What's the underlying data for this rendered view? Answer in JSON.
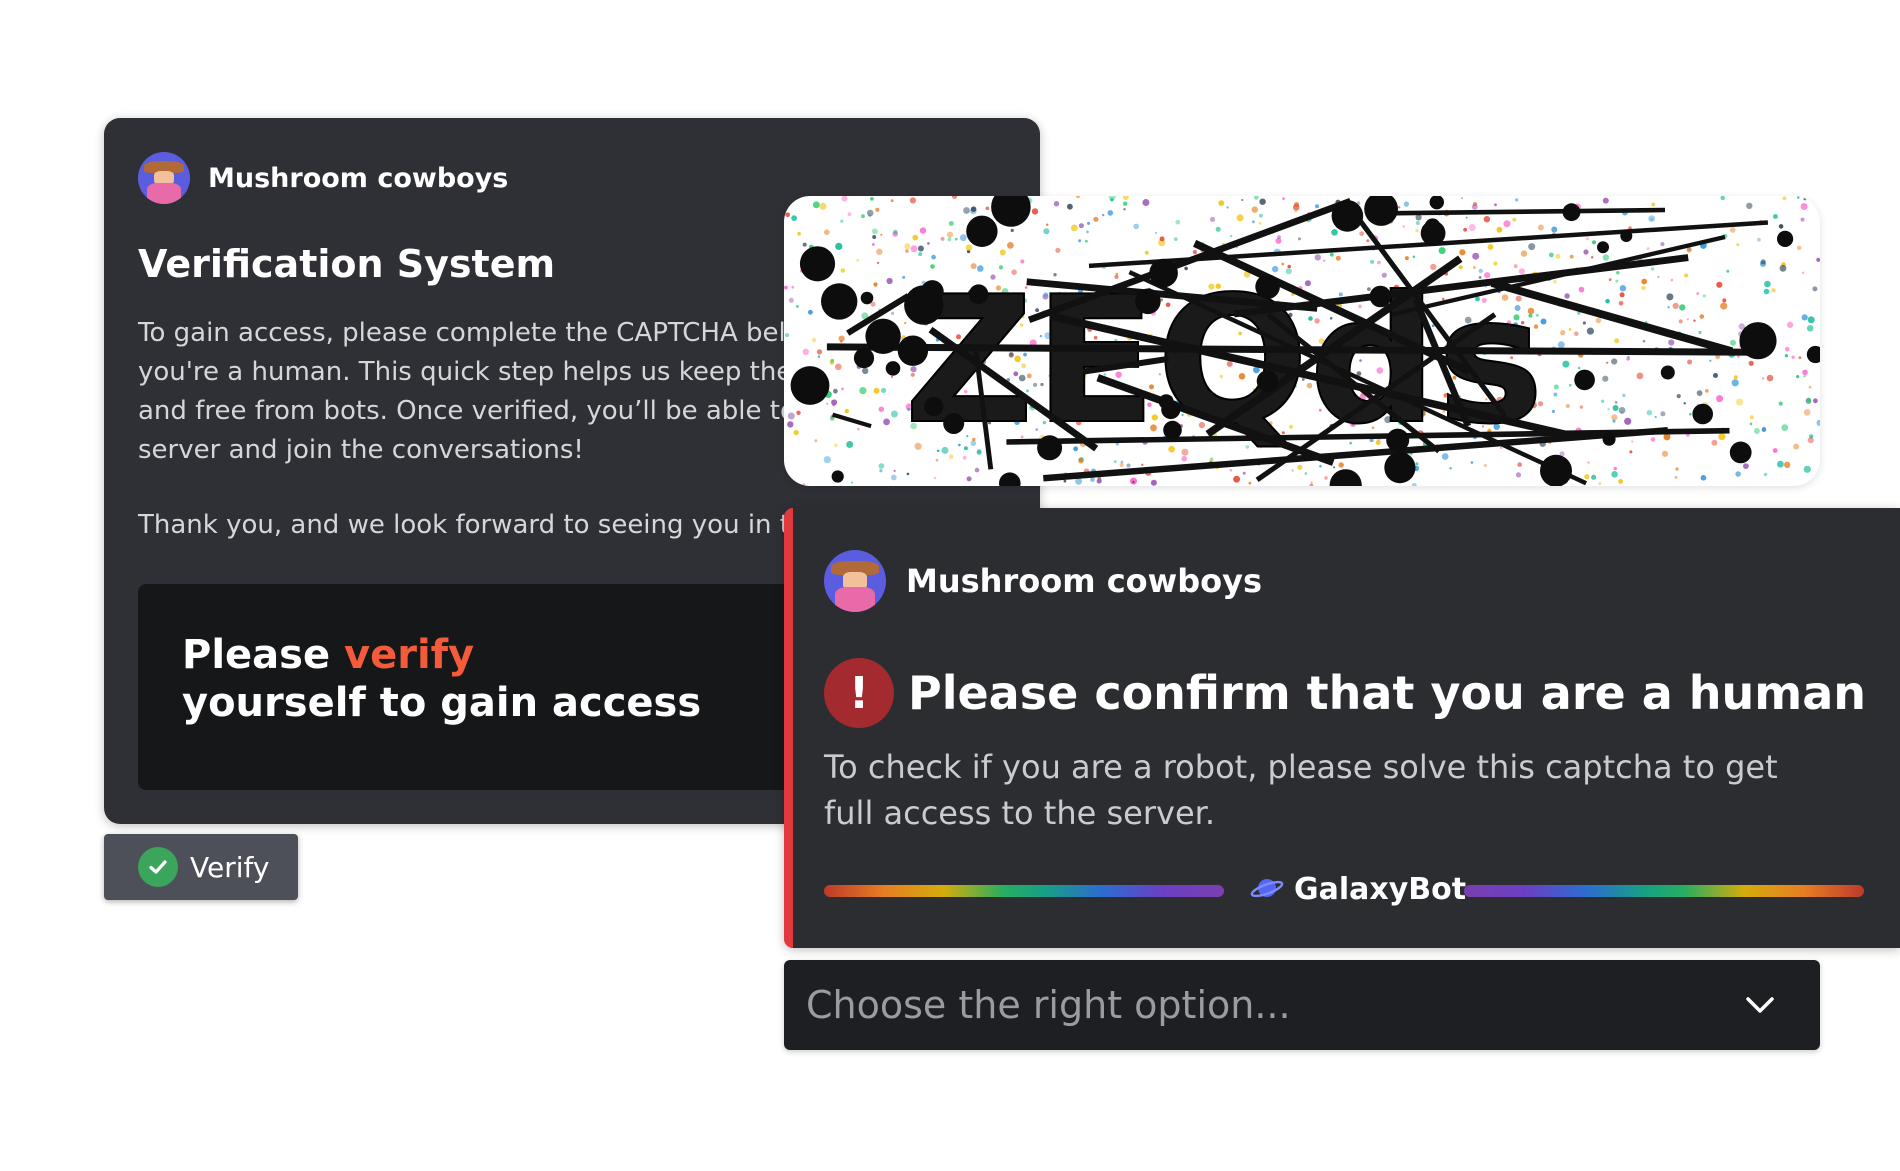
{
  "verification_card": {
    "author": "Mushroom cowboys",
    "title": "Verification System",
    "description": "To gain access, please complete the CAPTCHA bel\nyou're a human. This quick step helps us keep the c\nand free from bots. Once verified, you’ll be able to\nserver and join the conversations!",
    "thanks": "Thank you, and we look forward to seeing you in th",
    "banner": {
      "line1_prefix": "Please ",
      "line1_accent": "verify",
      "line2": "yourself to gain access"
    },
    "verify_button": "Verify"
  },
  "captcha_image": {
    "text": "ZEQds"
  },
  "captcha_embed": {
    "author": "Mushroom cowboys",
    "headline": "Please confirm that you are a human",
    "body": "To check if you are a robot, please solve this captcha to get full access to the server.",
    "footer_brand": "GalaxyBot"
  },
  "option_select": {
    "placeholder": "Choose the right option..."
  },
  "colors": {
    "embed_accent": "#e03a3e",
    "verify_accent": "#f45b3a",
    "success": "#3ba55c"
  },
  "icons": [
    "avatar-mushroom-cowboy",
    "check-circle-icon",
    "exclamation-icon",
    "planet-icon",
    "chevron-down-icon"
  ]
}
